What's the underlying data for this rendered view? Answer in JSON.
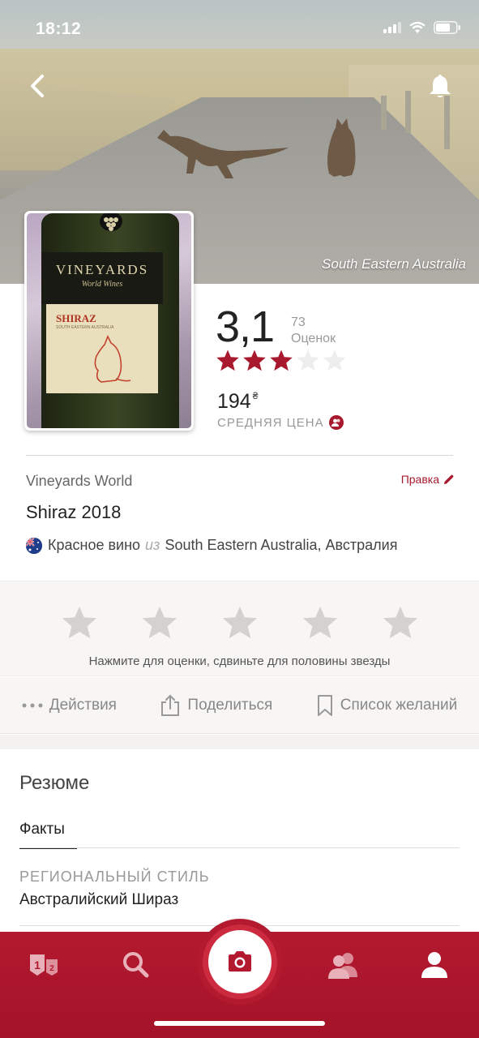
{
  "status_bar": {
    "time": "18:12"
  },
  "hero": {
    "caption": "South Eastern Australia",
    "back_icon": "chevron-left-icon",
    "notify_icon": "bell-icon"
  },
  "bottle_label": {
    "brand": "VINEYARDS",
    "sub": "World Wines",
    "variety": "SHIRAZ",
    "region": "SOUTH EASTERN AUSTRALIA"
  },
  "rating": {
    "average": "3,1",
    "count": "73",
    "count_label": "Оценок",
    "stars_filled": 3,
    "stars_total": 5,
    "star_color": "#a8192e"
  },
  "price": {
    "value": "194",
    "currency": "₴",
    "label": "СРЕДНЯЯ ЦЕНА"
  },
  "wine": {
    "winery": "Vineyards World",
    "edit_label": "Правка",
    "name": "Shiraz 2018",
    "type": "Красное вино",
    "from_word": "из",
    "region": "South Eastern Australia, Австралия"
  },
  "user_rate": {
    "hint": "Нажмите для оценки, сдвиньте для половины звезды"
  },
  "actions": {
    "actions_label": "Действия",
    "share_label": "Поделиться",
    "wishlist_label": "Список желаний"
  },
  "summary": {
    "title": "Резюме",
    "tab_facts": "Факты",
    "regional_style_label": "РЕГИОНАЛЬНЫЙ СТИЛЬ",
    "regional_style_value": "Австралийский Шираз"
  },
  "bottom_nav": {
    "items": [
      "rank-icon",
      "search-icon",
      "camera-icon",
      "friends-icon",
      "profile-icon"
    ],
    "accent": "#b3192f"
  }
}
